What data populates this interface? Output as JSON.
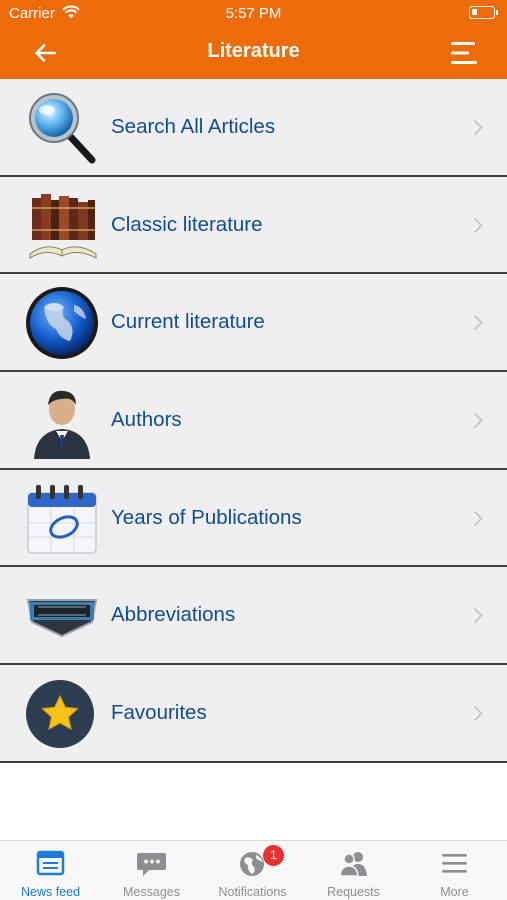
{
  "status_bar": {
    "carrier": "Carrier",
    "time": "5:57 PM"
  },
  "nav": {
    "title": "Literature"
  },
  "menu": [
    {
      "label": "Search All Articles",
      "icon": "magnifier-icon"
    },
    {
      "label": "Classic literature",
      "icon": "old-books-icon"
    },
    {
      "label": "Current literature",
      "icon": "globe-icon"
    },
    {
      "label": "Authors",
      "icon": "businessman-icon"
    },
    {
      "label": "Years of Publications",
      "icon": "calendar-icon"
    },
    {
      "label": "Abbreviations",
      "icon": "abbreviations-badge-icon"
    },
    {
      "label": "Favourites",
      "icon": "star-icon"
    }
  ],
  "tabs": [
    {
      "label": "News feed",
      "icon": "news-feed-icon",
      "active": true
    },
    {
      "label": "Messages",
      "icon": "chat-bubble-icon"
    },
    {
      "label": "Notifications",
      "icon": "globe-notification-icon",
      "badge": "1"
    },
    {
      "label": "Requests",
      "icon": "people-icon"
    },
    {
      "label": "More",
      "icon": "hamburger-icon"
    }
  ],
  "colors": {
    "header": "#ec6c0b",
    "link": "#114b96",
    "active_tab": "#1f7bd6",
    "badge": "#e8322f"
  }
}
